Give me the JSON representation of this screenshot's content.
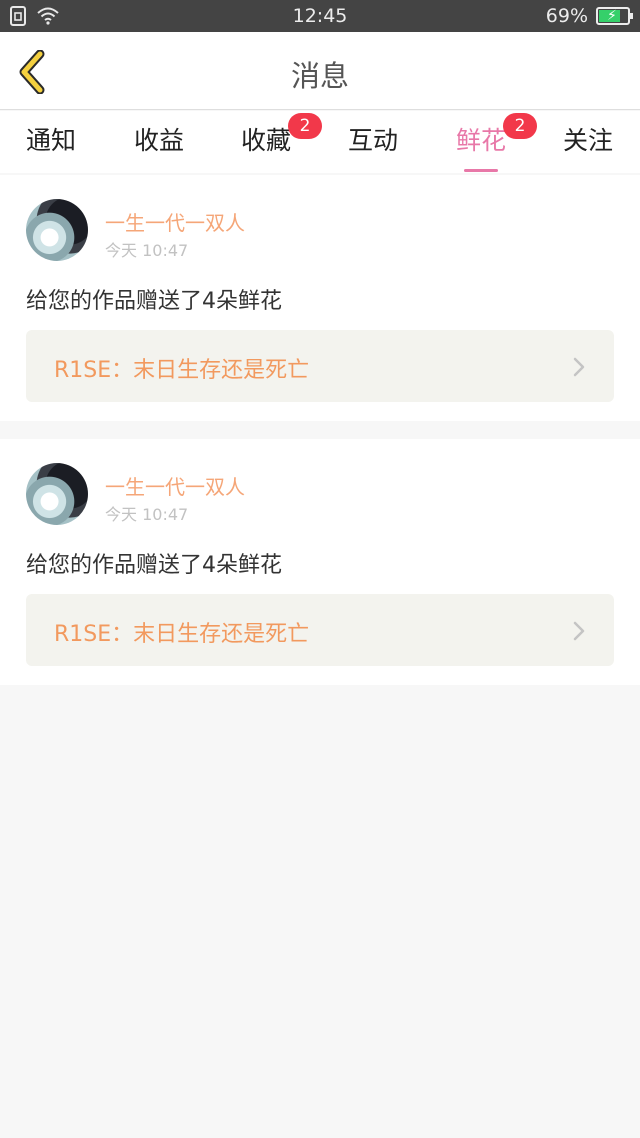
{
  "status_bar": {
    "time": "12:45",
    "battery_percent": "69%",
    "battery_level": 0.69,
    "icons": [
      "sim-icon",
      "wifi-icon",
      "battery-icon"
    ]
  },
  "header": {
    "title": "消息",
    "back_icon": "chevron-left-icon"
  },
  "tabs": [
    {
      "label": "通知",
      "badge": null,
      "active": false
    },
    {
      "label": "收益",
      "badge": null,
      "active": false
    },
    {
      "label": "收藏",
      "badge": "2",
      "active": false
    },
    {
      "label": "互动",
      "badge": null,
      "active": false
    },
    {
      "label": "鲜花",
      "badge": "2",
      "active": true
    },
    {
      "label": "关注",
      "badge": null,
      "active": false
    }
  ],
  "messages": [
    {
      "username": "一生一代一双人",
      "time": "今天 10:47",
      "text": "给您的作品赠送了4朵鲜花",
      "work_title": "R1SE：末日生存还是死亡"
    },
    {
      "username": "一生一代一双人",
      "time": "今天 10:47",
      "text": "给您的作品赠送了4朵鲜花",
      "work_title": "R1SE：末日生存还是死亡"
    }
  ],
  "colors": {
    "accent": "#e878a8",
    "badge": "#f2384a",
    "username": "#f5a678",
    "work_title": "#f2995e",
    "back_icon": "#f4d03f"
  }
}
